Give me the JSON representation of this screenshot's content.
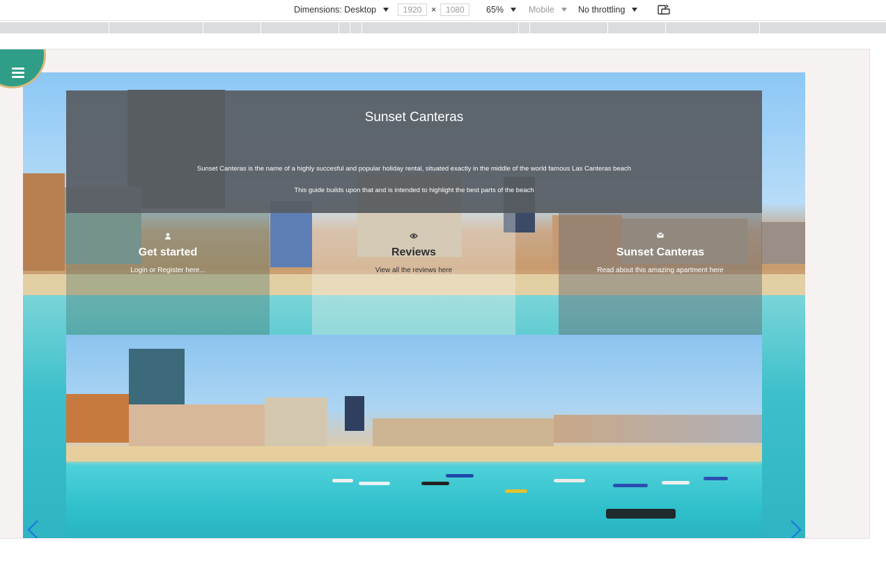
{
  "devtools": {
    "dimensions_label": "Dimensions: Desktop",
    "width": "1920",
    "height": "1080",
    "times": "×",
    "zoom": "65%",
    "device_type": "Mobile",
    "throttling": "No throttling",
    "rotate_icon": "rotate-icon"
  },
  "site": {
    "menu_icon": "hamburger-icon",
    "title": "Sunset Canteras",
    "description_1": "Sunset Canteras is the name of a highly succesful and popular holiday rental, situated exactly in the middle of the world famous Las Canteras beach",
    "description_2": "This guide builds upon that and is intended to highlight the best parts of the beach",
    "cards": [
      {
        "icon": "user-icon",
        "title": "Get started",
        "subtitle": "Login or Register here..."
      },
      {
        "icon": "eye-icon",
        "title": "Reviews",
        "subtitle": "View all the reviews here"
      },
      {
        "icon": "envelope-icon",
        "title": "Sunset Canteras",
        "subtitle": "Read about this amazing apartment here"
      }
    ],
    "carousel": {
      "prev_icon": "chevron-left-icon",
      "next_icon": "chevron-right-icon"
    }
  },
  "colors": {
    "fab": "#2f9d87",
    "fab_border": "#d6b97a",
    "panel": "#585c62",
    "arrow": "#1e7fd8"
  }
}
